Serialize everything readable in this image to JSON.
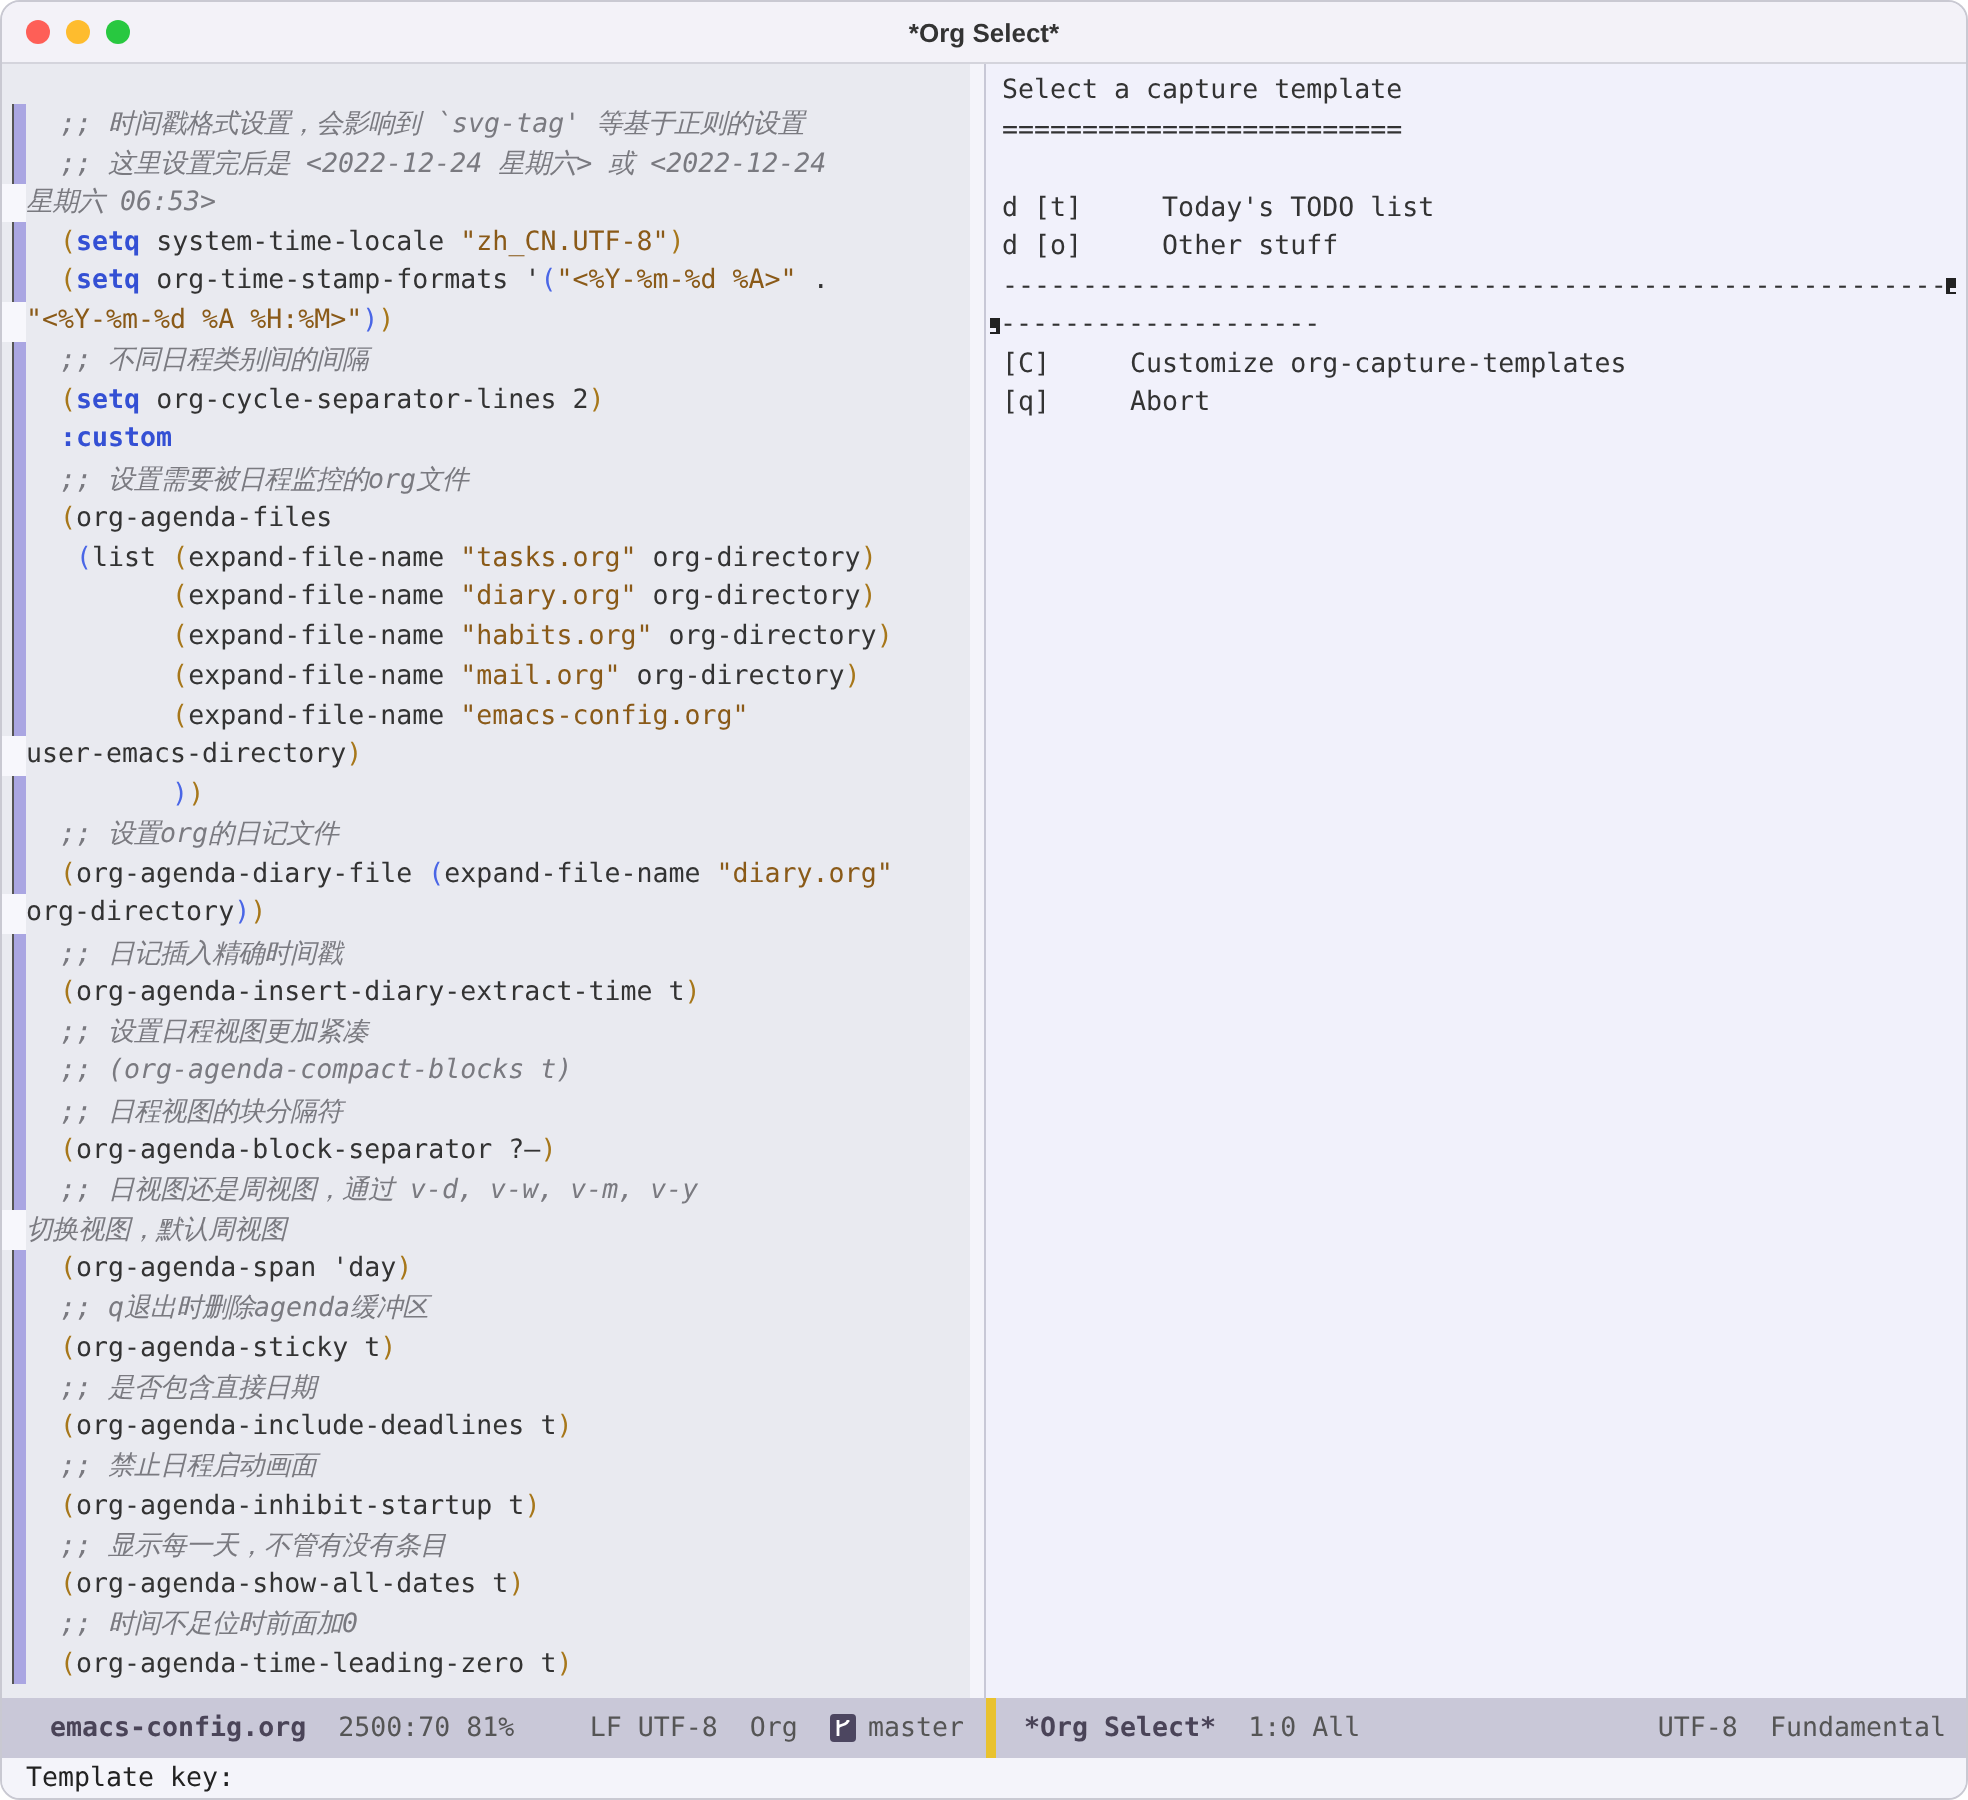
{
  "window": {
    "title": "*Org Select*"
  },
  "left_pane": {
    "lines": [
      {
        "wrapped": false,
        "segments": [
          {
            "kind": "comment",
            "text": "  ;; 时间戳格式设置，会影响到 `svg-tag' 等基于正则的设置"
          }
        ]
      },
      {
        "wrapped": false,
        "segments": [
          {
            "kind": "comment",
            "text": "  ;; 这里设置完后是 <2022-12-24 星期六> 或 <2022-12-24"
          }
        ]
      },
      {
        "wrapped": true,
        "segments": [
          {
            "kind": "comment",
            "text": "星期六 06:53>"
          }
        ]
      },
      {
        "wrapped": false,
        "segments": [
          {
            "kind": "paren",
            "text": "  ("
          },
          {
            "kind": "keyword",
            "text": "setq"
          },
          {
            "kind": "plain",
            "text": " system-time-locale "
          },
          {
            "kind": "string",
            "text": "\"zh_CN.UTF-8\""
          },
          {
            "kind": "paren",
            "text": ")"
          }
        ]
      },
      {
        "wrapped": false,
        "segments": [
          {
            "kind": "paren",
            "text": "  ("
          },
          {
            "kind": "keyword",
            "text": "setq"
          },
          {
            "kind": "plain",
            "text": " org-time-stamp-formats '"
          },
          {
            "kind": "paren_inner",
            "text": "("
          },
          {
            "kind": "string",
            "text": "\"<%Y-%m-%d %A>\""
          },
          {
            "kind": "plain",
            "text": " ."
          }
        ]
      },
      {
        "wrapped": true,
        "segments": [
          {
            "kind": "string",
            "text": "\"<%Y-%m-%d %A %H:%M>\""
          },
          {
            "kind": "paren_inner",
            "text": ")"
          },
          {
            "kind": "paren",
            "text": ")"
          }
        ]
      },
      {
        "wrapped": false,
        "segments": [
          {
            "kind": "comment",
            "text": "  ;; 不同日程类别间的间隔"
          }
        ]
      },
      {
        "wrapped": false,
        "segments": [
          {
            "kind": "paren",
            "text": "  ("
          },
          {
            "kind": "keyword",
            "text": "setq"
          },
          {
            "kind": "plain",
            "text": " org-cycle-separator-lines 2"
          },
          {
            "kind": "paren",
            "text": ")"
          }
        ]
      },
      {
        "wrapped": false,
        "segments": [
          {
            "kind": "keyword",
            "text": "  :custom"
          }
        ]
      },
      {
        "wrapped": false,
        "segments": [
          {
            "kind": "comment",
            "text": "  ;; 设置需要被日程监控的org文件"
          }
        ]
      },
      {
        "wrapped": false,
        "segments": [
          {
            "kind": "paren",
            "text": "  ("
          },
          {
            "kind": "plain",
            "text": "org-agenda-files"
          }
        ]
      },
      {
        "wrapped": false,
        "segments": [
          {
            "kind": "paren_inner",
            "text": "   ("
          },
          {
            "kind": "plain",
            "text": "list "
          },
          {
            "kind": "paren",
            "text": "("
          },
          {
            "kind": "plain",
            "text": "expand-file-name "
          },
          {
            "kind": "string",
            "text": "\"tasks.org\""
          },
          {
            "kind": "plain",
            "text": " org-directory"
          },
          {
            "kind": "paren",
            "text": ")"
          }
        ]
      },
      {
        "wrapped": false,
        "segments": [
          {
            "kind": "paren",
            "text": "         ("
          },
          {
            "kind": "plain",
            "text": "expand-file-name "
          },
          {
            "kind": "string",
            "text": "\"diary.org\""
          },
          {
            "kind": "plain",
            "text": " org-directory"
          },
          {
            "kind": "paren",
            "text": ")"
          }
        ]
      },
      {
        "wrapped": false,
        "segments": [
          {
            "kind": "paren",
            "text": "         ("
          },
          {
            "kind": "plain",
            "text": "expand-file-name "
          },
          {
            "kind": "string",
            "text": "\"habits.org\""
          },
          {
            "kind": "plain",
            "text": " org-directory"
          },
          {
            "kind": "paren",
            "text": ")"
          }
        ]
      },
      {
        "wrapped": false,
        "segments": [
          {
            "kind": "paren",
            "text": "         ("
          },
          {
            "kind": "plain",
            "text": "expand-file-name "
          },
          {
            "kind": "string",
            "text": "\"mail.org\""
          },
          {
            "kind": "plain",
            "text": " org-directory"
          },
          {
            "kind": "paren",
            "text": ")"
          }
        ]
      },
      {
        "wrapped": false,
        "segments": [
          {
            "kind": "paren",
            "text": "         ("
          },
          {
            "kind": "plain",
            "text": "expand-file-name "
          },
          {
            "kind": "string",
            "text": "\"emacs-config.org\""
          }
        ]
      },
      {
        "wrapped": true,
        "segments": [
          {
            "kind": "plain",
            "text": "user-emacs-directory"
          },
          {
            "kind": "paren",
            "text": ")"
          }
        ]
      },
      {
        "wrapped": false,
        "segments": [
          {
            "kind": "paren_inner",
            "text": "         )"
          },
          {
            "kind": "paren",
            "text": ")"
          }
        ]
      },
      {
        "wrapped": false,
        "segments": [
          {
            "kind": "comment",
            "text": "  ;; 设置org的日记文件"
          }
        ]
      },
      {
        "wrapped": false,
        "segments": [
          {
            "kind": "paren",
            "text": "  ("
          },
          {
            "kind": "plain",
            "text": "org-agenda-diary-file "
          },
          {
            "kind": "paren_inner",
            "text": "("
          },
          {
            "kind": "plain",
            "text": "expand-file-name "
          },
          {
            "kind": "string",
            "text": "\"diary.org\""
          }
        ]
      },
      {
        "wrapped": true,
        "segments": [
          {
            "kind": "plain",
            "text": "org-directory"
          },
          {
            "kind": "paren_inner",
            "text": ")"
          },
          {
            "kind": "paren",
            "text": ")"
          }
        ]
      },
      {
        "wrapped": false,
        "segments": [
          {
            "kind": "comment",
            "text": "  ;; 日记插入精确时间戳"
          }
        ]
      },
      {
        "wrapped": false,
        "segments": [
          {
            "kind": "paren",
            "text": "  ("
          },
          {
            "kind": "plain",
            "text": "org-agenda-insert-diary-extract-time t"
          },
          {
            "kind": "paren",
            "text": ")"
          }
        ]
      },
      {
        "wrapped": false,
        "segments": [
          {
            "kind": "comment",
            "text": "  ;; 设置日程视图更加紧凑"
          }
        ]
      },
      {
        "wrapped": false,
        "segments": [
          {
            "kind": "comment",
            "text": "  ;; (org-agenda-compact-blocks t)"
          }
        ]
      },
      {
        "wrapped": false,
        "segments": [
          {
            "kind": "comment",
            "text": "  ;; 日程视图的块分隔符"
          }
        ]
      },
      {
        "wrapped": false,
        "segments": [
          {
            "kind": "paren",
            "text": "  ("
          },
          {
            "kind": "plain",
            "text": "org-agenda-block-separator ?—"
          },
          {
            "kind": "paren",
            "text": ")"
          }
        ]
      },
      {
        "wrapped": false,
        "segments": [
          {
            "kind": "comment",
            "text": "  ;; 日视图还是周视图，通过 v-d, v-w, v-m, v-y"
          }
        ]
      },
      {
        "wrapped": true,
        "segments": [
          {
            "kind": "comment",
            "text": "切换视图，默认周视图"
          }
        ]
      },
      {
        "wrapped": false,
        "segments": [
          {
            "kind": "paren",
            "text": "  ("
          },
          {
            "kind": "plain",
            "text": "org-agenda-span 'day"
          },
          {
            "kind": "paren",
            "text": ")"
          }
        ]
      },
      {
        "wrapped": false,
        "segments": [
          {
            "kind": "comment",
            "text": "  ;; q退出时删除agenda缓冲区"
          }
        ]
      },
      {
        "wrapped": false,
        "segments": [
          {
            "kind": "paren",
            "text": "  ("
          },
          {
            "kind": "plain",
            "text": "org-agenda-sticky t"
          },
          {
            "kind": "paren",
            "text": ")"
          }
        ]
      },
      {
        "wrapped": false,
        "segments": [
          {
            "kind": "comment",
            "text": "  ;; 是否包含直接日期"
          }
        ]
      },
      {
        "wrapped": false,
        "segments": [
          {
            "kind": "paren",
            "text": "  ("
          },
          {
            "kind": "plain",
            "text": "org-agenda-include-deadlines t"
          },
          {
            "kind": "paren",
            "text": ")"
          }
        ]
      },
      {
        "wrapped": false,
        "segments": [
          {
            "kind": "comment",
            "text": "  ;; 禁止日程启动画面"
          }
        ]
      },
      {
        "wrapped": false,
        "segments": [
          {
            "kind": "paren",
            "text": "  ("
          },
          {
            "kind": "plain",
            "text": "org-agenda-inhibit-startup t"
          },
          {
            "kind": "paren",
            "text": ")"
          }
        ]
      },
      {
        "wrapped": false,
        "segments": [
          {
            "kind": "comment",
            "text": "  ;; 显示每一天，不管有没有条目"
          }
        ]
      },
      {
        "wrapped": false,
        "segments": [
          {
            "kind": "paren",
            "text": "  ("
          },
          {
            "kind": "plain",
            "text": "org-agenda-show-all-dates t"
          },
          {
            "kind": "paren",
            "text": ")"
          }
        ]
      },
      {
        "wrapped": false,
        "segments": [
          {
            "kind": "comment",
            "text": "  ;; 时间不足位时前面加0"
          }
        ]
      },
      {
        "wrapped": false,
        "segments": [
          {
            "kind": "paren",
            "text": "  ("
          },
          {
            "kind": "plain",
            "text": "org-agenda-time-leading-zero t"
          },
          {
            "kind": "paren",
            "text": ")"
          }
        ]
      }
    ]
  },
  "right_pane": {
    "lines": [
      {
        "kind": "text",
        "text": "Select a capture template"
      },
      {
        "kind": "text",
        "text": "========================="
      },
      {
        "kind": "blank"
      },
      {
        "kind": "text",
        "text": "d [t]     Today's TODO list"
      },
      {
        "kind": "text",
        "text": "d [o]     Other stuff"
      },
      {
        "kind": "wrap_head",
        "text": "-----------------------------------------------------------"
      },
      {
        "kind": "wrap_tail",
        "text": "--------------------"
      },
      {
        "kind": "text",
        "text": "[C]     Customize org-capture-templates"
      },
      {
        "kind": "text",
        "text": "[q]     Abort"
      }
    ]
  },
  "mode_lines": [
    {
      "active": false,
      "items": [
        {
          "kind": "buffer",
          "text": "emacs-config.org"
        },
        {
          "kind": "position",
          "text": "2500:70 81%"
        },
        {
          "kind": "encoding",
          "text": "LF UTF-8"
        },
        {
          "kind": "mode",
          "text": "Org"
        },
        {
          "kind": "branch",
          "text": "master"
        }
      ]
    },
    {
      "active": true,
      "items": [
        {
          "kind": "buffer",
          "text": "*Org Select*"
        },
        {
          "kind": "position",
          "text": "1:0 All"
        },
        {
          "kind": "encoding",
          "text": "UTF-8"
        },
        {
          "kind": "mode",
          "text": "Fundamental"
        }
      ]
    }
  ],
  "minibuffer": {
    "prompt": "Template key:"
  }
}
